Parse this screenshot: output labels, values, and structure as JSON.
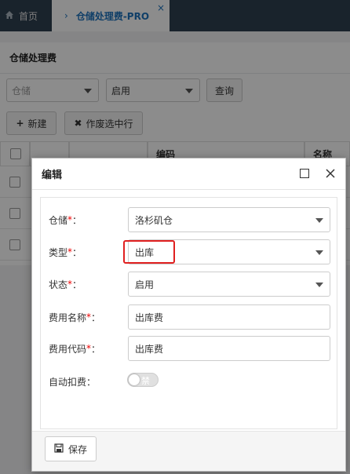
{
  "tabs": {
    "home": {
      "label": "首页",
      "icon": "home-icon"
    },
    "active": {
      "label": "仓储处理费-PRO",
      "icon": "chevron-right-icon",
      "close_icon": "close-icon"
    }
  },
  "page": {
    "title": "仓储处理费",
    "filters": {
      "warehouse_placeholder": "仓储",
      "status_value": "启用",
      "query_label": "查询"
    },
    "toolbar": {
      "new_label": "新建",
      "void_label": "作废选中行"
    },
    "table": {
      "columns": [
        "",
        "",
        "",
        "编码",
        "名称"
      ]
    }
  },
  "dialog": {
    "title": "编辑",
    "fields": [
      {
        "label": "仓储",
        "required": "*",
        "suffix": "：",
        "value": "洛杉矶仓",
        "type": "select"
      },
      {
        "label": "类型",
        "required": "*",
        "suffix": "：",
        "value": "出库",
        "type": "select"
      },
      {
        "label": "状态",
        "required": "*",
        "suffix": "：",
        "value": "启用",
        "type": "select"
      },
      {
        "label": "费用名称",
        "required": "*",
        "suffix": "：",
        "value": "出库费",
        "type": "input"
      },
      {
        "label": "费用代码",
        "required": "*",
        "suffix": "：",
        "value": "出库费",
        "type": "input"
      }
    ],
    "auto_deduct": {
      "label": "自动扣费",
      "suffix": "：",
      "toggle_text": "禁用",
      "enabled": false
    },
    "save_label": "保存"
  },
  "colors": {
    "topbar": "#2f4050",
    "accent": "#1e73be",
    "required": "#ee0000",
    "highlight": "#e02020"
  }
}
